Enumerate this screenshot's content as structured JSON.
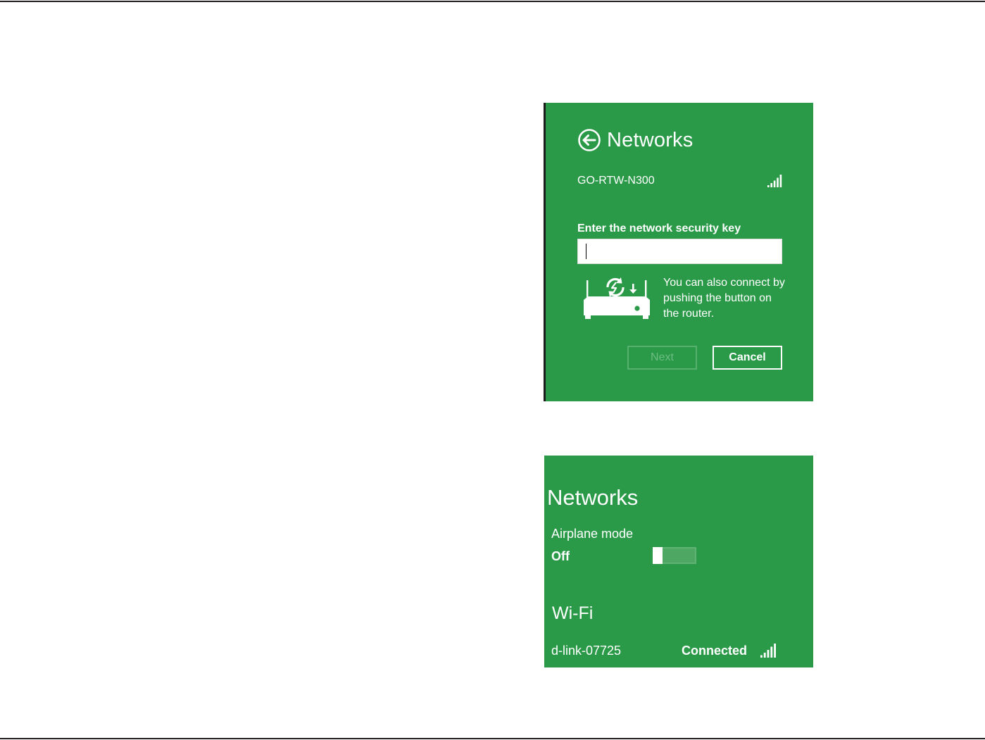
{
  "connect_dialog": {
    "title": "Networks",
    "network_name": "GO-RTW-N300",
    "key_label": "Enter the network security key",
    "key_value": "",
    "wps_hint": "You can also connect by pushing the button on the router.",
    "next_label": "Next",
    "cancel_label": "Cancel",
    "icons": [
      "back-arrow-icon",
      "signal-strength-icon",
      "router-wps-icon"
    ]
  },
  "networks_panel": {
    "title": "Networks",
    "airplane_mode_label": "Airplane mode",
    "airplane_mode_state": "Off",
    "wifi_heading": "Wi-Fi",
    "connected_network": "d-link-07725",
    "connection_status": "Connected",
    "icons": [
      "signal-strength-icon"
    ]
  },
  "colors": {
    "panel_green": "#2a9a48",
    "text": "#ffffff",
    "disabled_button": "#6cbc83"
  }
}
